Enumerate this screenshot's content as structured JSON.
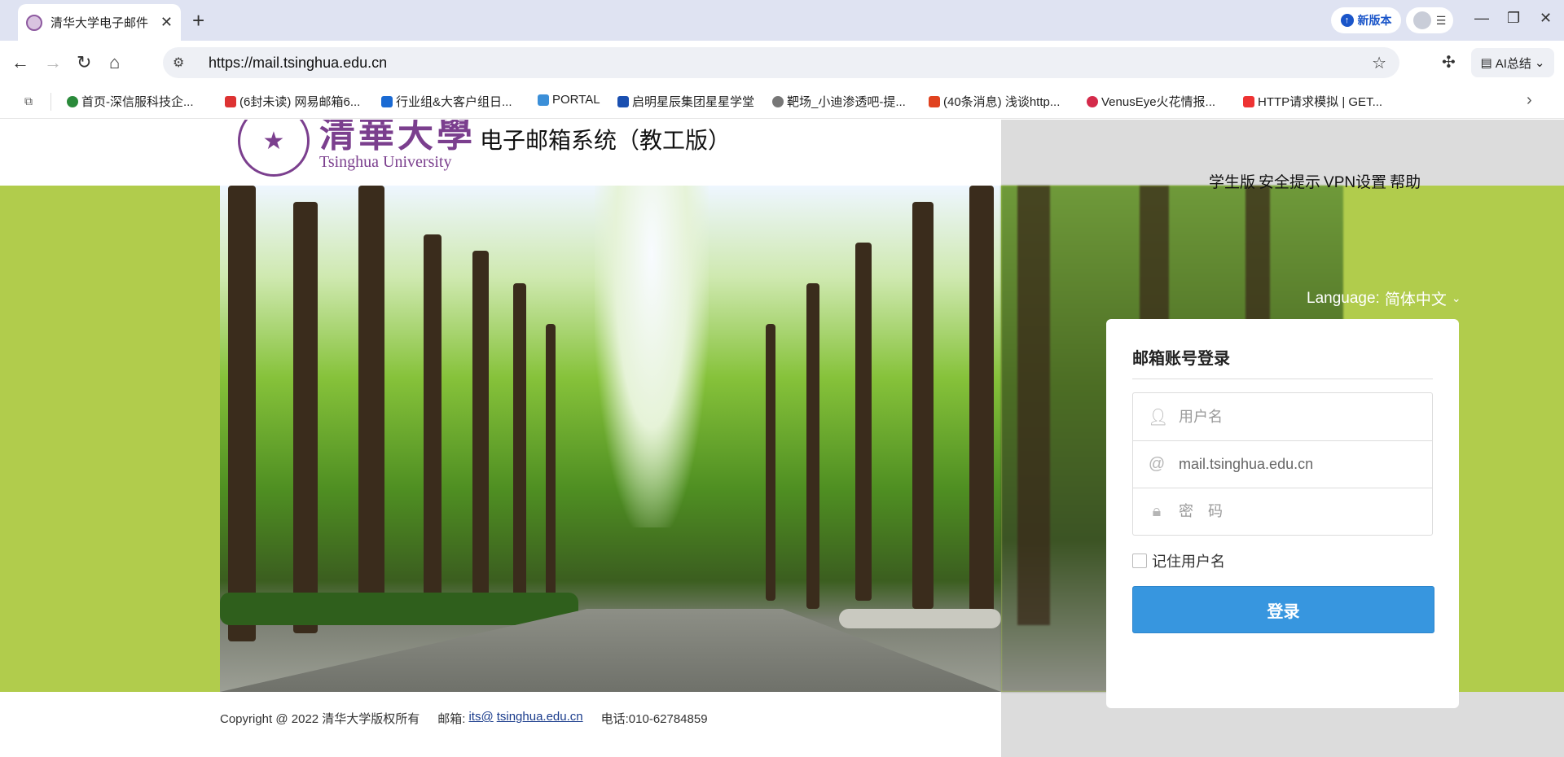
{
  "browser": {
    "tab_title": "清华大学电子邮件",
    "new_version_label": "新版本",
    "url": "https://mail.tsinghua.edu.cn",
    "ai_label": "AI总结",
    "bookmarks": [
      {
        "label": "首页-深信服科技企...",
        "color": "#2a8a3a"
      },
      {
        "label": "(6封未读) 网易邮箱6...",
        "color": "#d33"
      },
      {
        "label": "行业组&大客户组日...",
        "color": "#1a6ad3"
      },
      {
        "label": "PORTAL",
        "color": "#3b8fd8"
      },
      {
        "label": "启明星辰集团星星学堂",
        "color": "#1a4fb0"
      },
      {
        "label": "靶场_小迪渗透吧-提...",
        "color": "#777"
      },
      {
        "label": "(40条消息) 浅谈http...",
        "color": "#e0421f"
      },
      {
        "label": "VenusEye火花情报...",
        "color": "#d42a4a"
      },
      {
        "label": "HTTP请求模拟 | GET...",
        "color": "#e33"
      }
    ]
  },
  "header": {
    "logo_cn": "清華大學",
    "logo_en": "Tsinghua University",
    "system_title": "电子邮箱系统（教工版）"
  },
  "top_links": {
    "student": "学生版",
    "security": "安全提示",
    "vpn": "VPN设置",
    "help": "帮助"
  },
  "language": {
    "label": "Language:",
    "value": "简体中文"
  },
  "login": {
    "title": "邮箱账号登录",
    "username_placeholder": "用户名",
    "domain_value": "mail.tsinghua.edu.cn",
    "password_placeholder": "密　码",
    "remember_label": "记住用户名",
    "submit_label": "登录"
  },
  "footer": {
    "copyright": "Copyright @ 2022 清华大学版权所有",
    "email_label": "邮箱:",
    "email_user": "its@",
    "email_domain": "tsinghua.edu.cn",
    "phone": "电话:010-62784859"
  }
}
